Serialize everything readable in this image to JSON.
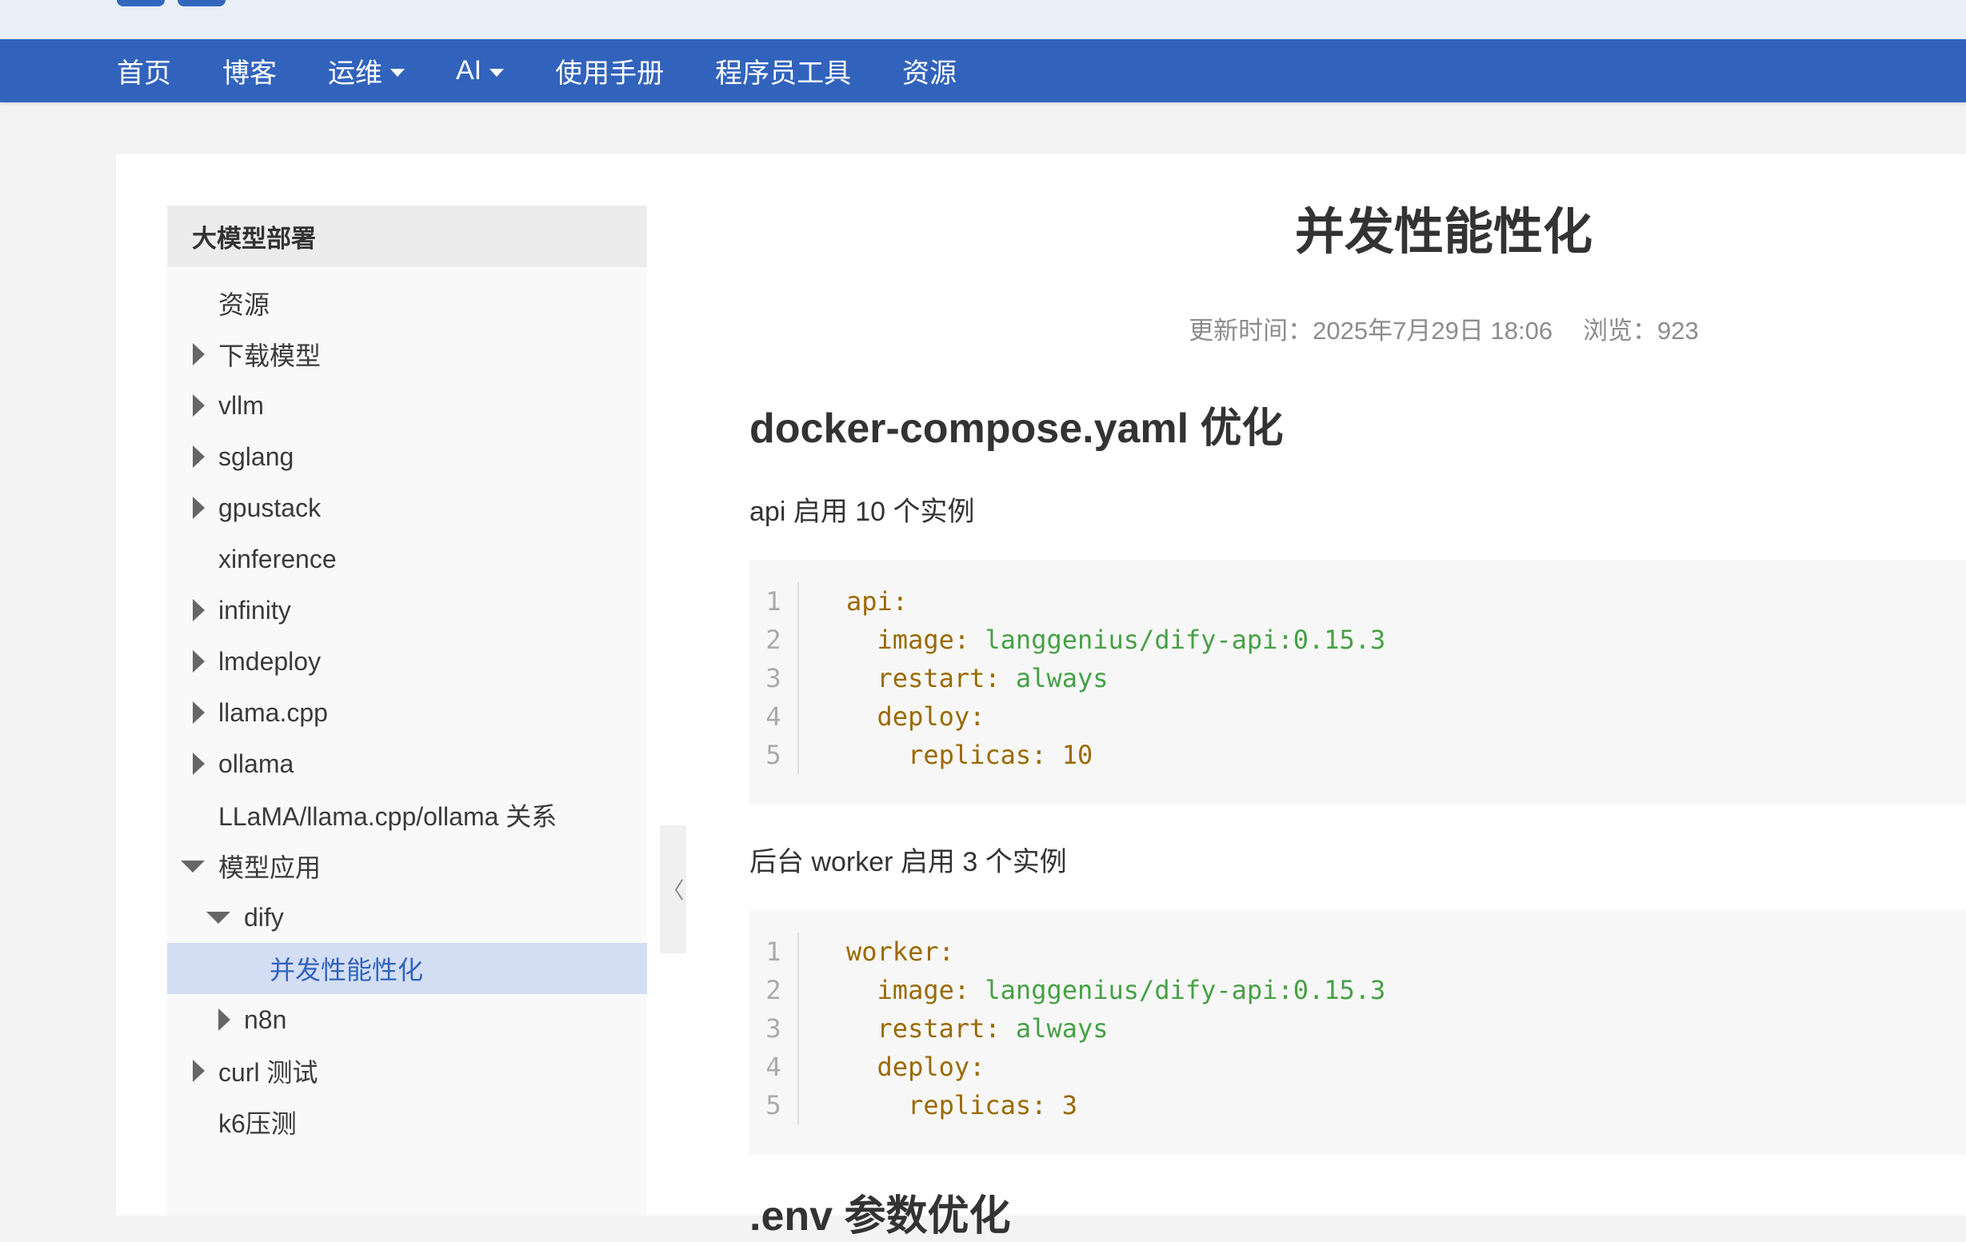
{
  "nav": {
    "items": [
      {
        "label": "首页",
        "dropdown": false
      },
      {
        "label": "博客",
        "dropdown": false
      },
      {
        "label": "运维",
        "dropdown": true
      },
      {
        "label": "AI",
        "dropdown": true
      },
      {
        "label": "使用手册",
        "dropdown": false
      },
      {
        "label": "程序员工具",
        "dropdown": false
      },
      {
        "label": "资源",
        "dropdown": false
      }
    ]
  },
  "sidebar": {
    "title": "大模型部署",
    "items": [
      {
        "label": "资源",
        "level": 0,
        "toggle": "none"
      },
      {
        "label": "下载模型",
        "level": 0,
        "toggle": "collapsed"
      },
      {
        "label": "vllm",
        "level": 0,
        "toggle": "collapsed"
      },
      {
        "label": "sglang",
        "level": 0,
        "toggle": "collapsed"
      },
      {
        "label": "gpustack",
        "level": 0,
        "toggle": "collapsed"
      },
      {
        "label": "xinference",
        "level": 0,
        "toggle": "none"
      },
      {
        "label": "infinity",
        "level": 0,
        "toggle": "collapsed"
      },
      {
        "label": "lmdeploy",
        "level": 0,
        "toggle": "collapsed"
      },
      {
        "label": "llama.cpp",
        "level": 0,
        "toggle": "collapsed"
      },
      {
        "label": "ollama",
        "level": 0,
        "toggle": "collapsed"
      },
      {
        "label": "LLaMA/llama.cpp/ollama 关系",
        "level": 0,
        "toggle": "none"
      },
      {
        "label": "模型应用",
        "level": 0,
        "toggle": "expanded"
      },
      {
        "label": "dify",
        "level": 1,
        "toggle": "expanded"
      },
      {
        "label": "并发性能性化",
        "level": 2,
        "toggle": "none",
        "active": true
      },
      {
        "label": "n8n",
        "level": 1,
        "toggle": "collapsed"
      },
      {
        "label": "curl 测试",
        "level": 0,
        "toggle": "collapsed"
      },
      {
        "label": "k6压测",
        "level": 0,
        "toggle": "none"
      }
    ],
    "collapse_glyph": "〈"
  },
  "article": {
    "title": "并发性能性化",
    "updated": "更新时间：2025年7月29日 18:06",
    "views": "浏览：923",
    "section1_heading": "docker-compose.yaml 优化",
    "para1": "api 启用 10 个实例",
    "code1": {
      "line_numbers": [
        "1",
        "2",
        "3",
        "4",
        "5"
      ],
      "lines": [
        {
          "indent": "",
          "key": "api:",
          "value": "",
          "value_type": ""
        },
        {
          "indent": "  ",
          "key": "image:",
          "value": " langgenius/dify-api:0.15.3",
          "value_type": "string"
        },
        {
          "indent": "  ",
          "key": "restart:",
          "value": " always",
          "value_type": "string"
        },
        {
          "indent": "  ",
          "key": "deploy:",
          "value": "",
          "value_type": ""
        },
        {
          "indent": "    ",
          "key": "replicas:",
          "value": " 10",
          "value_type": "number"
        }
      ]
    },
    "para2": "后台 worker 启用 3 个实例",
    "code2": {
      "line_numbers": [
        "1",
        "2",
        "3",
        "4",
        "5"
      ],
      "lines": [
        {
          "indent": "",
          "key": "worker:",
          "value": "",
          "value_type": ""
        },
        {
          "indent": "  ",
          "key": "image:",
          "value": " langgenius/dify-api:0.15.3",
          "value_type": "string"
        },
        {
          "indent": "  ",
          "key": "restart:",
          "value": " always",
          "value_type": "string"
        },
        {
          "indent": "  ",
          "key": "deploy:",
          "value": "",
          "value_type": ""
        },
        {
          "indent": "    ",
          "key": "replicas:",
          "value": " 3",
          "value_type": "number"
        }
      ]
    },
    "section2_heading": ".env 参数优化"
  },
  "colors": {
    "navbar": "#3263bc",
    "active_item_bg": "#d3def4",
    "yaml_key": "#9a6a00",
    "yaml_string": "#47a046"
  }
}
